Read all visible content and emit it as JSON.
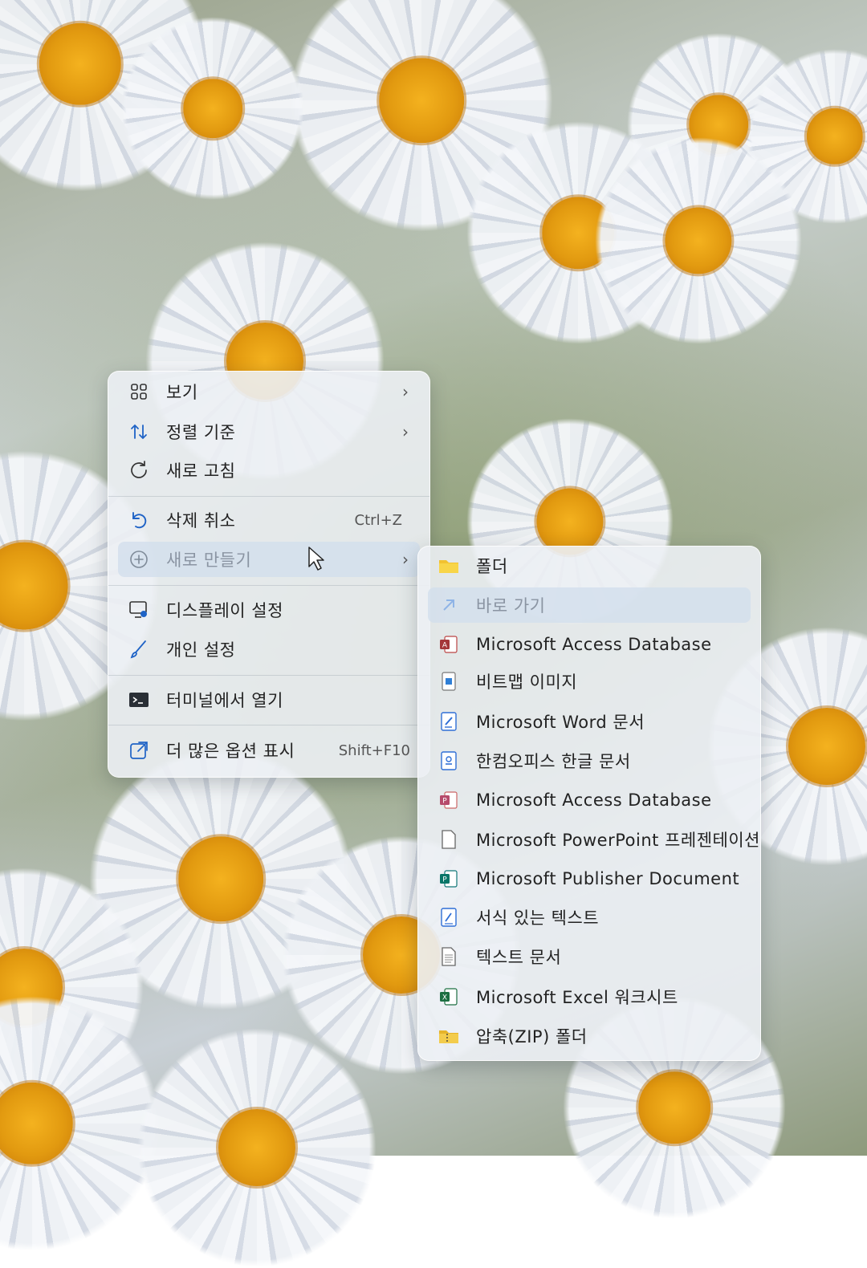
{
  "context_menu": {
    "items": [
      {
        "label": "보기",
        "icon": "view-grid-icon",
        "has_submenu": true
      },
      {
        "label": "정렬 기준",
        "icon": "sort-icon",
        "has_submenu": true
      },
      {
        "label": "새로 고침",
        "icon": "refresh-icon"
      },
      {
        "label": "삭제 취소",
        "icon": "undo-icon",
        "shortcut": "Ctrl+Z"
      },
      {
        "label": "새로 만들기",
        "icon": "new-icon",
        "has_submenu": true,
        "highlighted": true
      },
      {
        "label": "디스플레이 설정",
        "icon": "display-settings-icon"
      },
      {
        "label": "개인 설정",
        "icon": "brush-icon"
      },
      {
        "label": "터미널에서 열기",
        "icon": "terminal-icon"
      },
      {
        "label": "더 많은 옵션 표시",
        "icon": "more-options-icon",
        "shortcut": "Shift+F10"
      }
    ],
    "chevron": "›"
  },
  "new_submenu": {
    "items": [
      {
        "label": "폴더",
        "icon": "folder-icon"
      },
      {
        "label": "바로 가기",
        "icon": "shortcut-arrow-icon",
        "highlighted": true
      },
      {
        "label": "Microsoft Access Database",
        "icon": "access-icon"
      },
      {
        "label": "비트맵 이미지",
        "icon": "bitmap-icon"
      },
      {
        "label": "Microsoft Word 문서",
        "icon": "word-doc-icon"
      },
      {
        "label": "한컴오피스 한글 문서",
        "icon": "hwp-doc-icon"
      },
      {
        "label": "Microsoft Access Database",
        "icon": "access-icon"
      },
      {
        "label": "Microsoft PowerPoint 프레젠테이션",
        "icon": "blank-doc-icon"
      },
      {
        "label": "Microsoft Publisher Document",
        "icon": "publisher-icon"
      },
      {
        "label": "서식 있는 텍스트",
        "icon": "rich-text-icon"
      },
      {
        "label": "텍스트 문서",
        "icon": "text-doc-icon"
      },
      {
        "label": "Microsoft Excel 워크시트",
        "icon": "excel-icon"
      },
      {
        "label": "압축(ZIP) 폴더",
        "icon": "zip-folder-icon"
      }
    ]
  },
  "colors": {
    "accent": "#2f6fd6",
    "menu_background": "#ecf0f4",
    "highlight": "#d2deec"
  }
}
